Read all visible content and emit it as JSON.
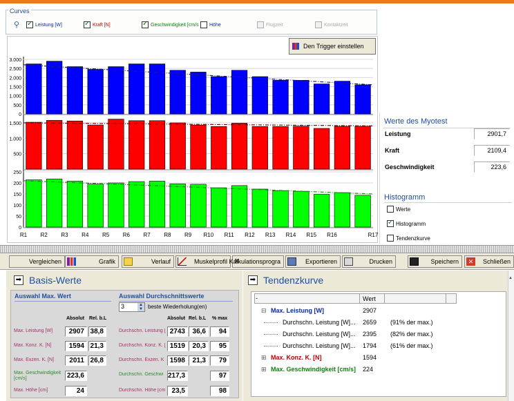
{
  "curves": {
    "title": "Curves",
    "items": [
      {
        "label": "Leistung [W]",
        "checked": true,
        "enabled": true
      },
      {
        "label": "Kraft [N]",
        "checked": true,
        "enabled": true
      },
      {
        "label": "Geschwindigkeit [cm/s",
        "checked": true,
        "enabled": true
      },
      {
        "label": "Höhe",
        "checked": false,
        "enabled": true
      },
      {
        "label": "Flugzeit",
        "checked": false,
        "enabled": false
      },
      {
        "label": "Kontaktzeit",
        "checked": false,
        "enabled": false
      }
    ]
  },
  "trigger_button": "Den Trigger einstellen",
  "chart_data": {
    "type": "bar",
    "categories": [
      "R1",
      "R2",
      "R3",
      "R4",
      "R5",
      "R6",
      "R7",
      "R8",
      "R9",
      "R10",
      "R11",
      "R12",
      "R13",
      "R14",
      "R15",
      "R16",
      "R17"
    ],
    "panels": [
      {
        "color": "#0000ff",
        "ticks": [
          "0",
          "500",
          "1.000",
          "1.500",
          "2.000",
          "2.500",
          "3.000"
        ],
        "ylim": [
          0,
          3000
        ],
        "values": [
          2750,
          2900,
          2600,
          2450,
          2600,
          2750,
          2750,
          2400,
          2300,
          2050,
          2400,
          2050,
          1850,
          1850,
          1650,
          1800,
          1600
        ],
        "trend": [
          2700,
          1600
        ]
      },
      {
        "color": "#ff0000",
        "ticks": [
          "500",
          "1.000",
          "1.500"
        ],
        "ylim": [
          0,
          1700
        ],
        "values": [
          1520,
          1580,
          1560,
          1430,
          1620,
          1570,
          1570,
          1500,
          1430,
          1380,
          1490,
          1380,
          1380,
          1390,
          1320,
          1390,
          1390
        ],
        "trend": [
          1500,
          1400
        ]
      },
      {
        "color": "#00ff00",
        "ticks": [
          "0",
          "50",
          "100",
          "150",
          "200",
          "250"
        ],
        "ylim": [
          0,
          250
        ],
        "values": [
          214,
          218,
          208,
          195,
          200,
          206,
          208,
          196,
          194,
          178,
          188,
          172,
          165,
          162,
          148,
          156,
          144
        ],
        "trend": [
          210,
          150
        ]
      }
    ]
  },
  "myotest": {
    "title": "Werte des Myotest",
    "rows": [
      {
        "label": "Leistung",
        "value": "2901,7"
      },
      {
        "label": "Kraft",
        "value": "2109,4"
      },
      {
        "label": "Geschwindigkeit",
        "value": "223,6"
      }
    ]
  },
  "histogramm": {
    "title": "Histogramm",
    "items": [
      {
        "label": "Werte",
        "checked": false
      },
      {
        "label": "Histogramm",
        "checked": true
      },
      {
        "label": "Tendenzkurve",
        "checked": false
      }
    ]
  },
  "toolbar": {
    "vergleichen": "Vergleichen",
    "grafik": "Grafik",
    "verlauf": "Verlauf",
    "muskelprofil": "Muskelprofil",
    "kalkulation": "Kalkulationsprogra",
    "exportieren": "Exportieren",
    "drucken": "Drucken",
    "speichern": "Speichern",
    "schliessen": "Schließen"
  },
  "basis": {
    "title": "Basis-Werte",
    "max_title": "Auswahl Max. Wert",
    "avg_title": "Auswahl Durchschnittswerte",
    "best_count": "3",
    "best_label": "beste Wiederholung(en)",
    "col_absolut": "Absolut",
    "col_rel": "Rel. b.L",
    "col_absolut2": "Absolut",
    "col_rel2": "Rel. b.L",
    "col_pct": "% max",
    "max_rows": [
      {
        "label": "Max. Leistung [W]",
        "abs": "2907",
        "rel": "38,8"
      },
      {
        "label": "Max. Konz. K. [N]",
        "abs": "1594",
        "rel": "21,3"
      },
      {
        "label": "Max. Exzen. K. [N]",
        "abs": "2011",
        "rel": "26,8"
      },
      {
        "label": "Max. Geschwindigkeit [cm/s]",
        "abs": "223,6",
        "rel": ""
      },
      {
        "label": "Max. Höhe [cm]",
        "abs": "24",
        "rel": ""
      }
    ],
    "avg_rows": [
      {
        "label": "Durchschn. Leistung [",
        "abs": "2743",
        "rel": "36,6",
        "pct": "94"
      },
      {
        "label": "Durchschn. Konz. K. [",
        "abs": "1519",
        "rel": "20,3",
        "pct": "95"
      },
      {
        "label": "Durchschn. Exzen. K",
        "abs": "1598",
        "rel": "21,3",
        "pct": "79"
      },
      {
        "label": "Durchschn. Geschwi",
        "abs": "217,3",
        "rel": "",
        "pct": "97"
      },
      {
        "label": "Durchschn. Höhe [cm",
        "abs": "23,5",
        "rel": "",
        "pct": "98"
      }
    ]
  },
  "tendenz": {
    "title": "Tendenzkurve",
    "col_dash": "-",
    "col_wert": "Wert",
    "rows": [
      {
        "label": "Max. Leistung [W]",
        "value": "2907",
        "note": "",
        "expander": "⊟",
        "indent": 0,
        "color": "#0a2aa0"
      },
      {
        "label": "Durchschn. Leistung [W]...",
        "value": "2659",
        "note": "(91% der max.)",
        "expander": "",
        "indent": 1,
        "color": "#000"
      },
      {
        "label": "Durchschn. Leistung [W]...",
        "value": "2395",
        "note": "(82% der max.)",
        "expander": "",
        "indent": 1,
        "color": "#000"
      },
      {
        "label": "Durchschn. Leistung [W]...",
        "value": "1794",
        "note": "(61% der max.)",
        "expander": "",
        "indent": 1,
        "color": "#000"
      },
      {
        "label": "Max. Konz. K. [N]",
        "value": "1594",
        "note": "",
        "expander": "⊞",
        "indent": 0,
        "color": "#c00000"
      },
      {
        "label": "Max. Geschwindigkeit [cm/s]",
        "value": "224",
        "note": "",
        "expander": "⊞",
        "indent": 0,
        "color": "#108010"
      }
    ]
  }
}
